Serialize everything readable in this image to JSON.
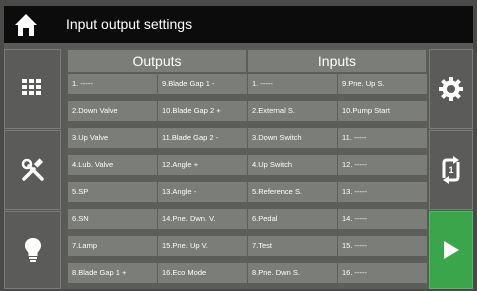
{
  "window": {
    "title": "Input output settings"
  },
  "columns": {
    "outputs": "Outputs",
    "inputs": "Inputs"
  },
  "outputs": [
    [
      "1. -----",
      "9.Blade Gap 1 -"
    ],
    [
      "2.Down Valve",
      "10.Blade Gap 2 +"
    ],
    [
      "3.Up Valve",
      "11.Blade Gap 2 -"
    ],
    [
      "4.Lub. Valve",
      "12.Angle +"
    ],
    [
      "5.SP",
      "13.Angle -"
    ],
    [
      "6.SN",
      "14.Pne. Dwn. V."
    ],
    [
      "7.Lamp",
      "15.Pne. Up V."
    ],
    [
      "8.Blade Gap 1 +",
      "16.Eco Mode"
    ]
  ],
  "inputs": [
    [
      "1. -----",
      "9.Pne. Up S."
    ],
    [
      "2.External S.",
      "10.Pump Start"
    ],
    [
      "3.Down Switch",
      "11. -----"
    ],
    [
      "4.Up Switch",
      "12. -----"
    ],
    [
      "5.Reference S.",
      "13. -----"
    ],
    [
      "6.Pedal",
      "14. -----"
    ],
    [
      "7.Test",
      "15. -----"
    ],
    [
      "8.Pne. Dwn S.",
      "16. -----"
    ]
  ],
  "colors": {
    "accent_green": "#3aa54a",
    "cell_bg": "#7b7d78",
    "title_bg": "#0c0c0c"
  },
  "icons": {
    "home": "home-icon",
    "grid": "grid-icon",
    "tools": "tools-icon",
    "bulb": "lightbulb-icon",
    "settings": "gear-icon",
    "sync": "rotate-icon",
    "play": "play-icon"
  }
}
